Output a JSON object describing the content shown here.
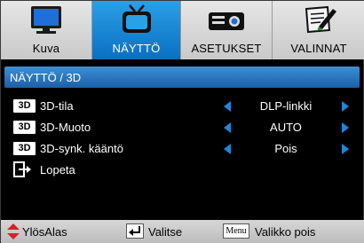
{
  "tabs": [
    {
      "label": "Kuva",
      "icon": "monitor-icon",
      "active": false
    },
    {
      "label": "NÄYTTÖ",
      "icon": "tv-icon",
      "active": true
    },
    {
      "label": "ASETUKSET",
      "icon": "projector-icon",
      "active": false
    },
    {
      "label": "VALINNAT",
      "icon": "notepad-pen-icon",
      "active": false
    }
  ],
  "section_title": "NÄYTTÖ / 3D",
  "rows": [
    {
      "badge": "3D",
      "label": "3D-tila",
      "value": "DLP-linkki"
    },
    {
      "badge": "3D",
      "label": "3D-Muoto",
      "value": "AUTO"
    },
    {
      "badge": "3D",
      "label": "3D-synk. kääntö",
      "value": "Pois"
    }
  ],
  "exit_label": "Lopeta",
  "footer": {
    "nav_label": "YlösAlas",
    "select_label": "Valitse",
    "menu_key": "Menu",
    "menu_label": "Valikko pois"
  },
  "colors": {
    "active_tab": "#1583d4",
    "section_header": "#2a78c4",
    "arrow": "#1f86d8",
    "footer_arrow": "#d8202a"
  }
}
